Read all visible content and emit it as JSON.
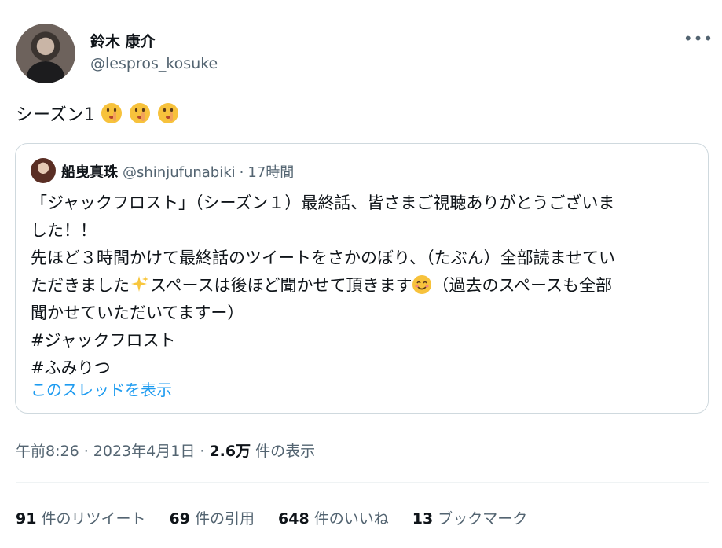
{
  "author": {
    "display_name": "鈴木 康介",
    "handle": "@lespros_kosuke"
  },
  "more_icon": "more-horizontal-icon",
  "tweet": {
    "text": "シーズン1",
    "emojis": [
      "shushing-face",
      "shushing-face",
      "shushing-face"
    ]
  },
  "quoted": {
    "name": "船曳真珠",
    "handle": "@shinjufunabiki",
    "dot": "·",
    "time": "17時間",
    "lines": {
      "l1": "「ジャックフロスト」（シーズン１）最終話、皆さまご視聴ありがとうございま",
      "l2": "した！！",
      "l3": "先ほど３時間かけて最終話のツイートをさかのぼり、（たぶん）全部読ませてい",
      "l4a": "ただきました",
      "l4b": "スペースは後ほど聞かせて頂きます",
      "l4c": "（過去のスペースも全部",
      "l5": "聞かせていただいてますー）",
      "l6": "#ジャックフロスト",
      "l7": "#ふみりつ"
    },
    "emojis": [
      "sparkles",
      "smiling-face-with-smiling-eyes"
    ],
    "thread_link": "このスレッドを表示"
  },
  "meta": {
    "time": "午前8:26 · 2023年4月1日 · ",
    "views_count": "2.6万",
    "views_label": " 件の表示"
  },
  "stats": {
    "retweets_count": "91",
    "retweets_label": " 件のリツイート",
    "quotes_count": "69",
    "quotes_label": " 件の引用",
    "likes_count": "648",
    "likes_label": " 件のいいね",
    "bookmarks_count": "13",
    "bookmarks_label": " ブックマーク"
  },
  "colors": {
    "link": "#1d9bf0",
    "secondary_text": "#536471",
    "primary_text": "#0f1419",
    "border": "#cfd9de"
  }
}
